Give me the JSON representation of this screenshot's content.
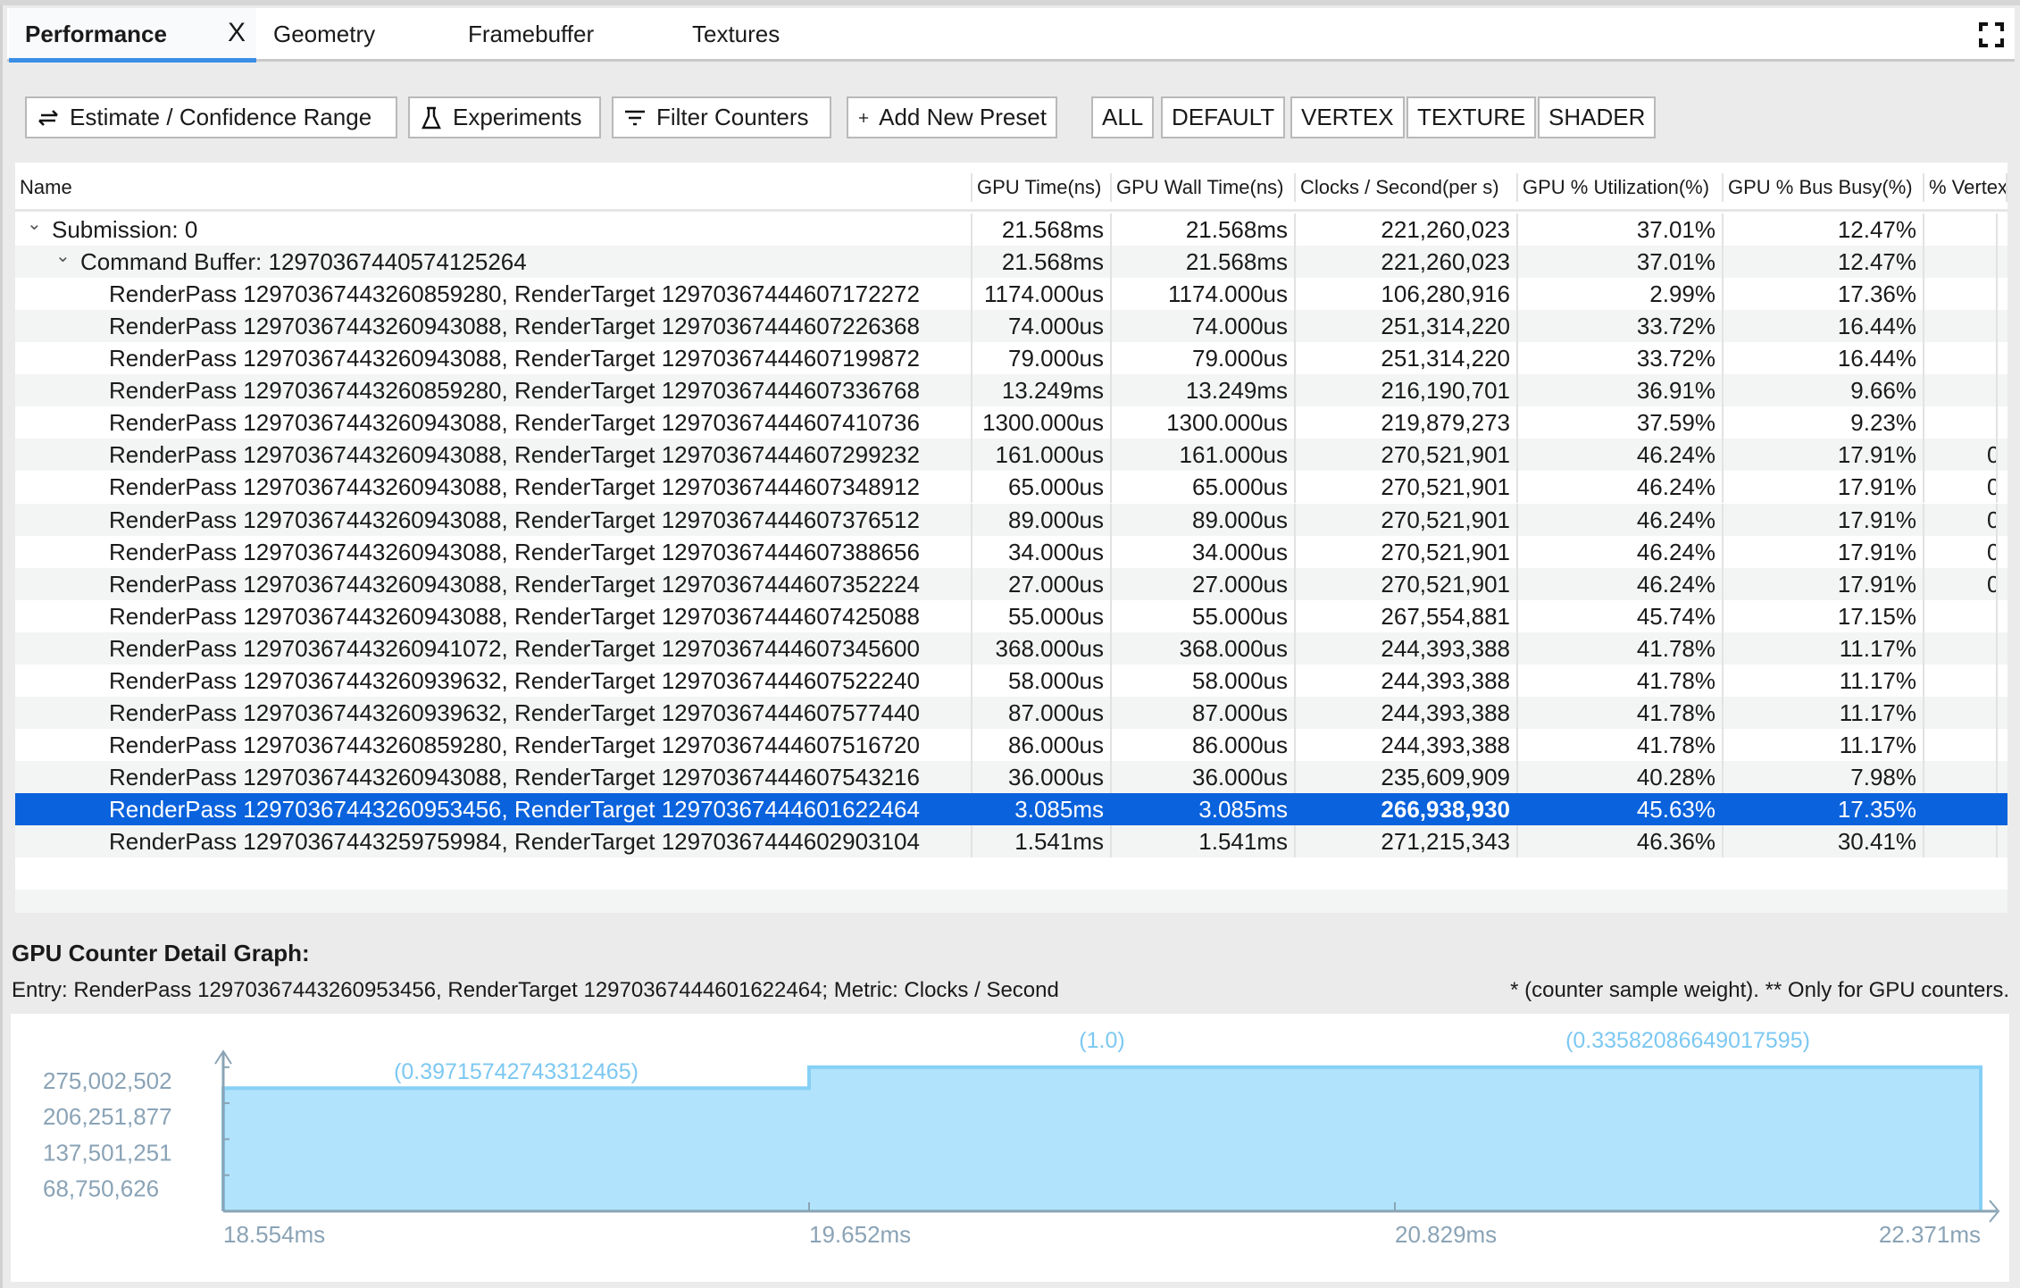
{
  "tabs": [
    {
      "label": "Performance",
      "active": true
    },
    {
      "label": "Geometry"
    },
    {
      "label": "Framebuffer"
    },
    {
      "label": "Textures"
    }
  ],
  "tab_close": "X",
  "toolbar": {
    "estimate": "Estimate / Confidence Range",
    "experiments": "Experiments",
    "filter": "Filter Counters",
    "add_preset": "Add New Preset",
    "presets": [
      "ALL",
      "DEFAULT",
      "VERTEX",
      "TEXTURE",
      "SHADER"
    ]
  },
  "table": {
    "columns": [
      "Name",
      "GPU Time(ns)",
      "GPU Wall Time(ns)",
      "Clocks / Second(per s)",
      "GPU % Utilization(%)",
      "GPU % Bus Busy(%)",
      "% Vertex"
    ],
    "rows": [
      {
        "level": 0,
        "expanded": true,
        "cells": [
          "Submission: 0",
          "21.568ms",
          "21.568ms",
          "221,260,023",
          "37.01%",
          "12.47%",
          ""
        ]
      },
      {
        "level": 1,
        "expanded": true,
        "cells": [
          "Command Buffer: 12970367440574125264",
          "21.568ms",
          "21.568ms",
          "221,260,023",
          "37.01%",
          "12.47%",
          ""
        ]
      },
      {
        "level": 2,
        "cells": [
          "RenderPass 12970367443260859280, RenderTarget 12970367444607172272",
          "1174.000us",
          "1174.000us",
          "106,280,916",
          "2.99%",
          "17.36%",
          ""
        ]
      },
      {
        "level": 2,
        "cells": [
          "RenderPass 12970367443260943088, RenderTarget 12970367444607226368",
          "74.000us",
          "74.000us",
          "251,314,220",
          "33.72%",
          "16.44%",
          ""
        ]
      },
      {
        "level": 2,
        "cells": [
          "RenderPass 12970367443260943088, RenderTarget 12970367444607199872",
          "79.000us",
          "79.000us",
          "251,314,220",
          "33.72%",
          "16.44%",
          ""
        ]
      },
      {
        "level": 2,
        "cells": [
          "RenderPass 12970367443260859280, RenderTarget 12970367444607336768",
          "13.249ms",
          "13.249ms",
          "216,190,701",
          "36.91%",
          "9.66%",
          ""
        ]
      },
      {
        "level": 2,
        "cells": [
          "RenderPass 12970367443260943088, RenderTarget 12970367444607410736",
          "1300.000us",
          "1300.000us",
          "219,879,273",
          "37.59%",
          "9.23%",
          ""
        ]
      },
      {
        "level": 2,
        "cells": [
          "RenderPass 12970367443260943088, RenderTarget 12970367444607299232",
          "161.000us",
          "161.000us",
          "270,521,901",
          "46.24%",
          "17.91%",
          "0"
        ]
      },
      {
        "level": 2,
        "cells": [
          "RenderPass 12970367443260943088, RenderTarget 12970367444607348912",
          "65.000us",
          "65.000us",
          "270,521,901",
          "46.24%",
          "17.91%",
          "0"
        ]
      },
      {
        "level": 2,
        "cells": [
          "RenderPass 12970367443260943088, RenderTarget 12970367444607376512",
          "89.000us",
          "89.000us",
          "270,521,901",
          "46.24%",
          "17.91%",
          "0"
        ]
      },
      {
        "level": 2,
        "cells": [
          "RenderPass 12970367443260943088, RenderTarget 12970367444607388656",
          "34.000us",
          "34.000us",
          "270,521,901",
          "46.24%",
          "17.91%",
          "0"
        ]
      },
      {
        "level": 2,
        "cells": [
          "RenderPass 12970367443260943088, RenderTarget 12970367444607352224",
          "27.000us",
          "27.000us",
          "270,521,901",
          "46.24%",
          "17.91%",
          "0"
        ]
      },
      {
        "level": 2,
        "cells": [
          "RenderPass 12970367443260943088, RenderTarget 12970367444607425088",
          "55.000us",
          "55.000us",
          "267,554,881",
          "45.74%",
          "17.15%",
          ""
        ]
      },
      {
        "level": 2,
        "cells": [
          "RenderPass 12970367443260941072, RenderTarget 12970367444607345600",
          "368.000us",
          "368.000us",
          "244,393,388",
          "41.78%",
          "11.17%",
          ""
        ]
      },
      {
        "level": 2,
        "cells": [
          "RenderPass 12970367443260939632, RenderTarget 12970367444607522240",
          "58.000us",
          "58.000us",
          "244,393,388",
          "41.78%",
          "11.17%",
          ""
        ]
      },
      {
        "level": 2,
        "cells": [
          "RenderPass 12970367443260939632, RenderTarget 12970367444607577440",
          "87.000us",
          "87.000us",
          "244,393,388",
          "41.78%",
          "11.17%",
          ""
        ]
      },
      {
        "level": 2,
        "cells": [
          "RenderPass 12970367443260859280, RenderTarget 12970367444607516720",
          "86.000us",
          "86.000us",
          "244,393,388",
          "41.78%",
          "11.17%",
          ""
        ]
      },
      {
        "level": 2,
        "cells": [
          "RenderPass 12970367443260943088, RenderTarget 12970367444607543216",
          "36.000us",
          "36.000us",
          "235,609,909",
          "40.28%",
          "7.98%",
          ""
        ]
      },
      {
        "level": 2,
        "selected": true,
        "cells": [
          "RenderPass 12970367443260953456, RenderTarget 12970367444601622464",
          "3.085ms",
          "3.085ms",
          "266,938,930",
          "45.63%",
          "17.35%",
          ""
        ]
      },
      {
        "level": 2,
        "cells": [
          "RenderPass 12970367443259759984, RenderTarget 12970367444602903104",
          "1.541ms",
          "1.541ms",
          "271,215,343",
          "46.36%",
          "30.41%",
          ""
        ]
      }
    ]
  },
  "graph": {
    "title": "GPU Counter Detail Graph:",
    "entry": "Entry: RenderPass 12970367443260953456, RenderTarget 12970367444601622464; Metric: Clocks / Second",
    "note": "* (counter sample weight). ** Only for GPU counters."
  },
  "chart_data": {
    "type": "area",
    "step": true,
    "x_ticks": [
      "18.554ms",
      "19.652ms",
      "20.829ms",
      "22.371ms"
    ],
    "y_ticks": [
      "275,002,502",
      "206,251,877",
      "137,501,251",
      "68,750,626"
    ],
    "y_tick_values": [
      275002502,
      206251877,
      137501251,
      68750626
    ],
    "ylim": [
      0,
      307000000
    ],
    "segments": [
      {
        "start": "18.554ms",
        "end": "19.652ms",
        "value": 235000000,
        "weight_label": "(0.39715742743312465)"
      },
      {
        "start": "19.652ms",
        "end": "20.829ms",
        "value": 275002502,
        "weight_label": "(1.0)"
      },
      {
        "start": "20.829ms",
        "end": "22.371ms",
        "value": 275002502,
        "weight_label": "(0.33582086649017595)"
      }
    ],
    "colors": {
      "fill": "#b1e3fc",
      "stroke": "#86d0f5",
      "label": "#7cc8f2",
      "axis": "#8aa4b5",
      "tick_text": "#8aa3b6"
    }
  }
}
